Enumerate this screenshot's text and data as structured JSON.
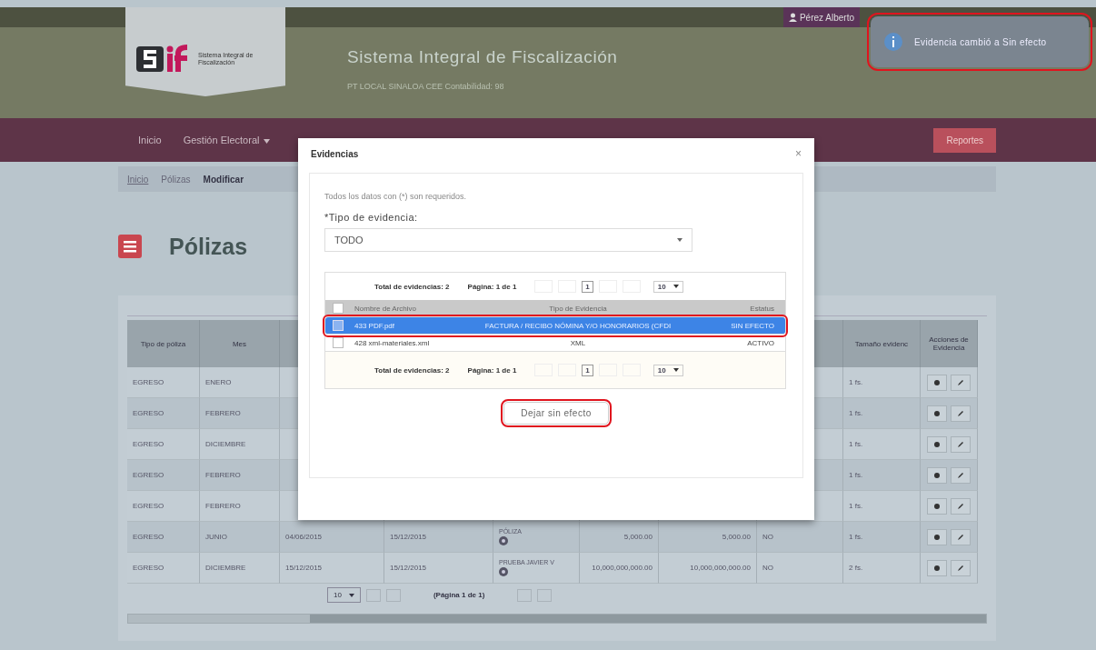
{
  "top_bar": {
    "user": "Pérez Alberto",
    "notification": {
      "text": "Evidencia cambió a Sin efecto",
      "highlighted": true
    }
  },
  "header": {
    "logo_text": "Sistema Integral de Fiscalización",
    "title": "Sistema Integral de Fiscalización",
    "subtitle": "PT LOCAL SINALOA CEE Contabilidad: 98"
  },
  "nav": {
    "items": [
      {
        "label": "Inicio",
        "dropdown": false
      },
      {
        "label": "Gestión Electoral",
        "dropdown": true
      }
    ],
    "reports_button": "Reportes"
  },
  "breadcrumb": [
    {
      "label": "Inicio",
      "current": false
    },
    {
      "label": "Pólizas",
      "current": false
    },
    {
      "label": "Modificar",
      "current": true
    }
  ],
  "page_title": "Pólizas",
  "table": {
    "columns": [
      "Tipo de póliza",
      "Mes",
      "Tamaño evidenc",
      "Acciones de Evidencia"
    ],
    "rows": [
      {
        "tipo": "EGRESO",
        "mes": "ENERO",
        "tamano": "1 fs."
      },
      {
        "tipo": "EGRESO",
        "mes": "FEBRERO",
        "tamano": "1 fs."
      },
      {
        "tipo": "EGRESO",
        "mes": "DICIEMBRE",
        "tamano": "1 fs."
      },
      {
        "tipo": "EGRESO",
        "mes": "FEBRERO",
        "tamano": "1 fs."
      },
      {
        "tipo": "EGRESO",
        "mes": "FEBRERO",
        "tamano": "1 fs."
      },
      {
        "tipo": "EGRESO",
        "mes": "JUNIO",
        "fecha_1": "04/06/2015",
        "fecha_2": "15/12/2015",
        "concepto": "PÓLIZA",
        "monto_1": "5,000.00",
        "monto_2": "5,000.00",
        "flag": "NO",
        "tamano": "1 fs."
      },
      {
        "tipo": "EGRESO",
        "mes": "DICIEMBRE",
        "fecha_1": "15/12/2015",
        "fecha_2": "15/12/2015",
        "concepto": "PRUEBA JAVIER V",
        "monto_1": "10,000,000,000.00",
        "monto_2": "10,000,000,000.00",
        "flag": "NO",
        "tamano": "2 fs."
      }
    ],
    "pager": {
      "page_size": "10",
      "page_text": "(Página 1 de 1)"
    }
  },
  "modal": {
    "title": "Evidencias",
    "close": "×",
    "note": "Todos los datos con (*) son requeridos.",
    "field_label": "*Tipo de evidencia:",
    "select_value": "TODO",
    "pagers": [
      {
        "total": "Total de evidencias: 2",
        "page": "Página: 1 de 1",
        "page_input": "1",
        "page_size": "10"
      },
      {
        "total": "Total de evidencias: 2",
        "page": "Página: 1 de 1",
        "page_input": "1",
        "page_size": "10"
      }
    ],
    "columns": [
      "Nombre de Archivo",
      "Tipo de Evidencia",
      "Estatus"
    ],
    "all_checked": false,
    "rows": [
      {
        "name": "433 PDF.pdf",
        "type": "FACTURA / RECIBO NÓMINA Y/O HONORARIOS (CFDI",
        "status": "SIN EFECTO",
        "selected": true,
        "checked": true,
        "highlighted": true
      },
      {
        "name": "428 xml-materiales.xml",
        "type": "XML",
        "status": "ACTIVO",
        "selected": false,
        "checked": false,
        "highlighted": false
      }
    ],
    "button": {
      "label": "Dejar sin efecto",
      "highlighted": true
    }
  }
}
